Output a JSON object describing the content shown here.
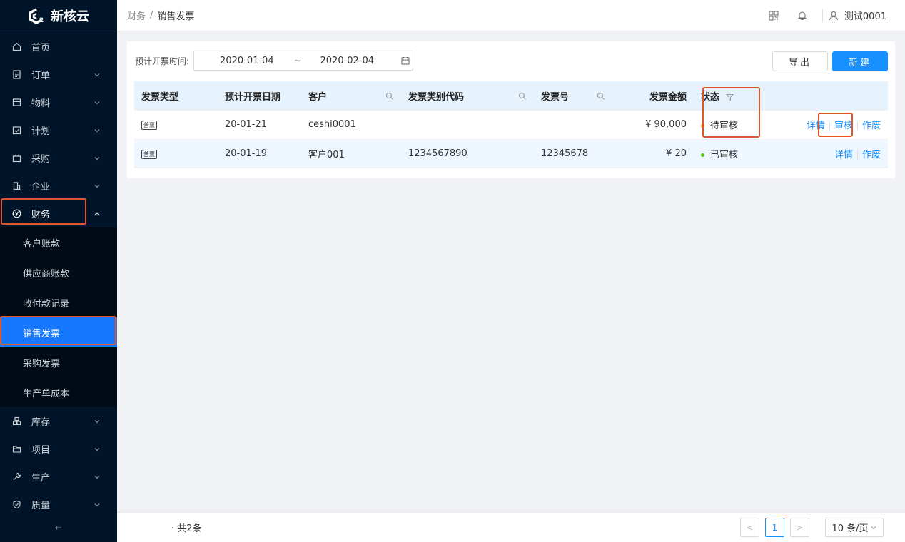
{
  "app": {
    "logo_text": "新核云"
  },
  "sidebar": {
    "items": [
      {
        "label": "首页"
      },
      {
        "label": "订单"
      },
      {
        "label": "物料"
      },
      {
        "label": "计划"
      },
      {
        "label": "采购"
      },
      {
        "label": "企业"
      },
      {
        "label": "财务"
      },
      {
        "label": "库存"
      },
      {
        "label": "项目"
      },
      {
        "label": "生产"
      },
      {
        "label": "质量"
      }
    ],
    "finance_sub": [
      {
        "label": "客户账款"
      },
      {
        "label": "供应商账款"
      },
      {
        "label": "收付款记录"
      },
      {
        "label": "销售发票"
      },
      {
        "label": "采购发票"
      },
      {
        "label": "生产单成本"
      }
    ],
    "collapse_glyph": "←"
  },
  "header": {
    "breadcrumb_parent": "财务",
    "breadcrumb_sep": "/",
    "breadcrumb_current": "销售发票",
    "user_name": "测试0001"
  },
  "filter": {
    "label": "预计开票时间:",
    "start_date": "2020-01-04",
    "tilde": "~",
    "end_date": "2020-02-04"
  },
  "buttons": {
    "export": "导出",
    "new": "新建"
  },
  "table": {
    "headers": {
      "type": "发票类型",
      "date": "预计开票日期",
      "customer": "客户",
      "code": "发票类别代码",
      "number": "发票号",
      "amount": "发票金额",
      "status": "状态"
    },
    "rows": [
      {
        "type": "普票",
        "date": "20-01-21",
        "customer": "ceshi0001",
        "code": "",
        "number": "",
        "amount": "¥ 90,000",
        "status": "待审核",
        "status_color": "#faad14",
        "op1": "详情",
        "op2": "审核",
        "op3": "作废"
      },
      {
        "type": "普票",
        "date": "20-01-19",
        "customer": "客户001",
        "code": "1234567890",
        "number": "12345678",
        "amount": "¥ 20",
        "status": "已审核",
        "status_color": "#52c41a",
        "op1": "详情",
        "op3": "作废"
      }
    ]
  },
  "footer": {
    "total": "· 共2条",
    "page_prev": "<",
    "page_current": "1",
    "page_next": ">",
    "page_size": "10 条/页"
  },
  "colors": {
    "accent": "#1890ff",
    "highlight": "#e0562c",
    "sidebar_bg": "#001529"
  }
}
